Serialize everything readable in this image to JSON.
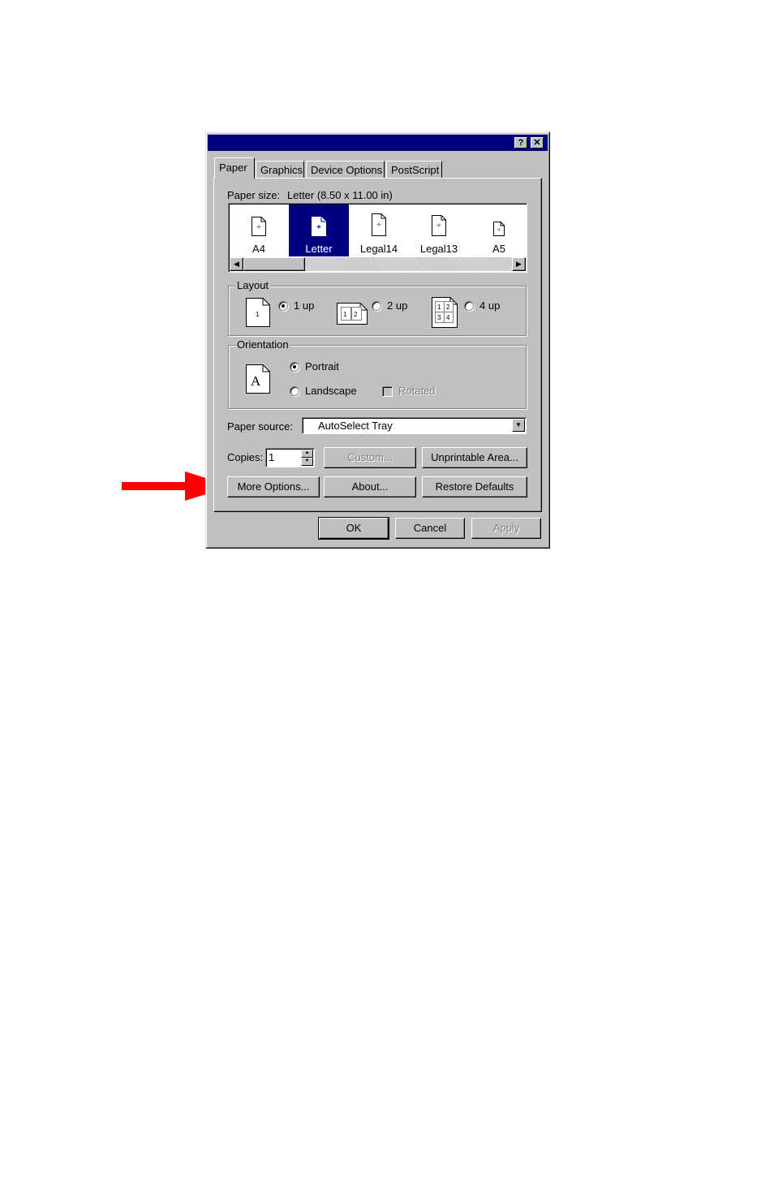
{
  "window": {
    "help_button": "?",
    "close_button": "✕"
  },
  "tabs": [
    {
      "label": "Paper",
      "active": true
    },
    {
      "label": "Graphics",
      "active": false
    },
    {
      "label": "Device Options",
      "active": false
    },
    {
      "label": "PostScript",
      "active": false
    }
  ],
  "paper_size": {
    "label": "Paper size:",
    "value": "Letter (8.50 x 11.00 in)",
    "items": [
      "A4",
      "Letter",
      "Legal14",
      "Legal13",
      "A5"
    ],
    "selected": "Letter"
  },
  "layout": {
    "label": "Layout",
    "options": [
      {
        "label": "1 up",
        "icon_text": "1",
        "checked": true
      },
      {
        "label": "2 up",
        "icon_text": "1 2",
        "checked": false
      },
      {
        "label": "4 up",
        "icon_text": "1 2 3 4",
        "checked": false
      }
    ]
  },
  "orientation": {
    "label": "Orientation",
    "icon_letter": "A",
    "portrait": "Portrait",
    "landscape": "Landscape",
    "rotated": "Rotated",
    "selected": "Portrait"
  },
  "paper_source": {
    "label": "Paper source:",
    "value": "AutoSelect Tray"
  },
  "copies": {
    "label": "Copies:",
    "value": "1"
  },
  "buttons": {
    "custom": "Custom...",
    "unprintable_area": "Unprintable Area...",
    "more_options": "More Options...",
    "about": "About...",
    "restore_defaults": "Restore Defaults",
    "ok": "OK",
    "cancel": "Cancel",
    "apply": "Apply"
  },
  "colors": {
    "titlebar": "#000080",
    "dialog_face": "#c0c0c0",
    "annotation_arrow": "#ff0000"
  }
}
